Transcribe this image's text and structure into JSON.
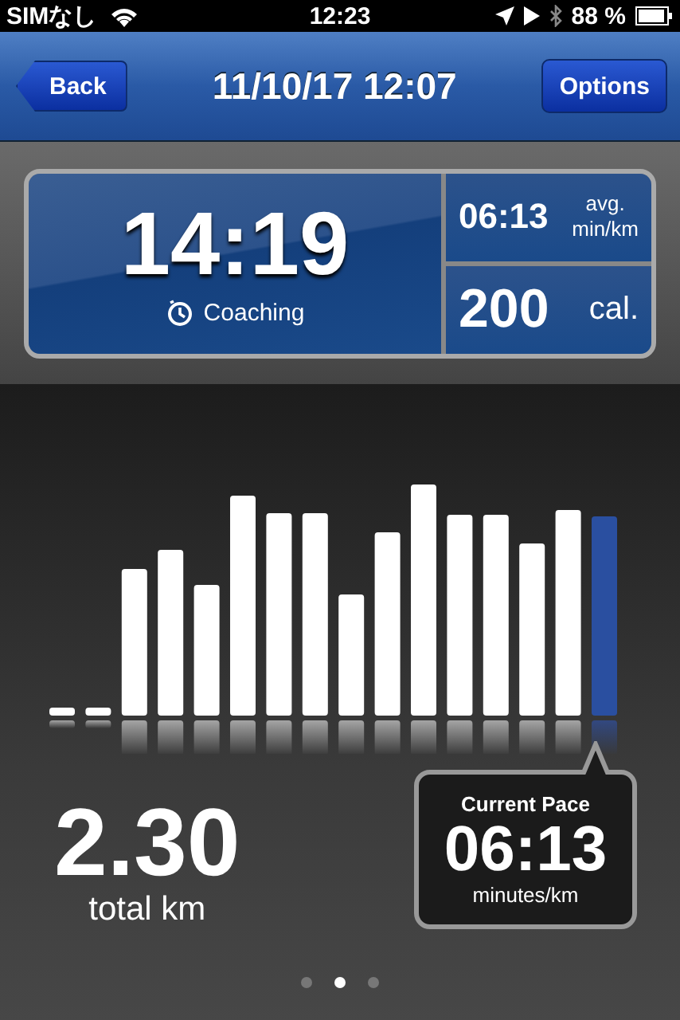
{
  "status_bar": {
    "carrier": "SIMなし",
    "time": "12:23",
    "battery": "88 %"
  },
  "nav_bar": {
    "back": "Back",
    "title": "11/10/17 12:07",
    "options": "Options"
  },
  "summary": {
    "duration": "14:19",
    "coaching": "Coaching",
    "avg_pace": "06:13",
    "avg_label": "avg.",
    "avg_unit": "min/km",
    "calories": "200",
    "calories_unit": "cal."
  },
  "distance": {
    "value": "2.30",
    "label": "total km"
  },
  "current_pace": {
    "title": "Current Pace",
    "value": "06:13",
    "unit": "minutes/km"
  },
  "page_dots": [
    {
      "selected": false
    },
    {
      "selected": true
    },
    {
      "selected": false
    }
  ]
}
